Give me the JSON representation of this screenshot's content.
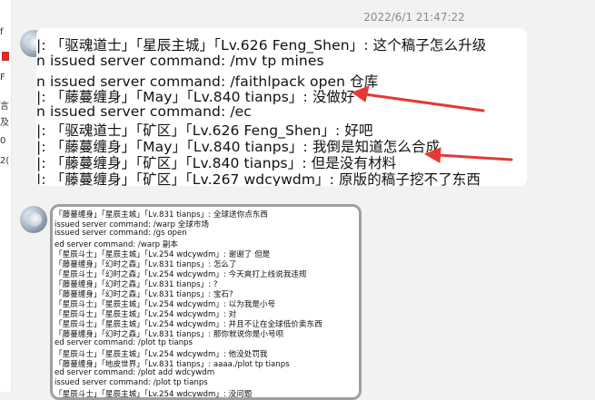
{
  "timestamp": "2022/6/1 21:47:22",
  "left_strip": {
    "glyphs": [
      "f",
      "F",
      "言",
      "及",
      "0",
      "2("
    ]
  },
  "message1": {
    "lines": [
      "|: 「驱魂道士」「星辰主城」「Lv.626 Feng_Shen」: 这个稿子怎么升级",
      "n issued server command: /mv tp mines",
      "n issued server command: /faithlpack open 仓库",
      "|: 「藤蔓缠身」「May」「Lv.840 tianps」: 没做好",
      "n issued server command: /ec",
      "|: 「驱魂道士」「矿区」「Lv.626 Feng_Shen」: 好吧",
      "|: 「藤蔓缠身」「May」「Lv.840 tianps」: 我倒是知道怎么合成",
      "|: 「藤蔓缠身」「矿区」「Lv.840 tianps」: 但是没有材料",
      "|: 「藤蔓缠身」「矿区」「Lv.267 wdcywdm」: 原版的稿子挖不了东西"
    ]
  },
  "message2": {
    "lines": [
      "「藤蔓缠身」「星辰主城」「Lv.831 tianps」: 全球送你点东西",
      "issued server command: /warp 全球市场",
      "issued server command: /gs open",
      "ed server command: /warp 副本",
      "「星辰斗士」「星辰主城」「Lv.254 wdcywdm」: 谢谢了 但是",
      "「藤蔓缠身」「幻时之森」「Lv.831 tianps」: 怎么了",
      "「星辰斗士」「幻时之森」「Lv.254 wdcywdm」: 今天爽打上线说我违规",
      "「藤蔓缠身」「幻时之森」「Lv.831 tianps」: ?",
      "「藤蔓缠身」「幻时之森」「Lv.831 tianps」: 宝石?",
      "「星辰斗士」「星辰主城」「Lv.254 wdcywdm」: 以为我是小号",
      "「星辰斗士」「星辰主城」「Lv.254 wdcywdm」: 对",
      "「星辰斗士」「星辰主城」「Lv.254 wdcywdm」: 并且不让在全球低价卖东西",
      "「藤蔓缠身」「幻时之森」「Lv.831 tianps」: 那你就说你是小号呗",
      "ed server command: /plot tp tianps",
      "「星辰斗士」「星辰主城」「Lv.254 wdcywdm」: 他没处罚我",
      "「藤蔓缠身」「地皮世界」「Lv.831 tianps」: aaaa./plot tp tianps",
      "ed server command: /plot add wdcywdm",
      "issued server command: /plot tp tianps",
      "「星辰斗士」「星辰主城」「Lv.254 wdcywdm」: 没问题"
    ]
  },
  "colors": {
    "arrow": "#e53935",
    "background": "#f2f2f2",
    "bubble": "#ffffff"
  }
}
